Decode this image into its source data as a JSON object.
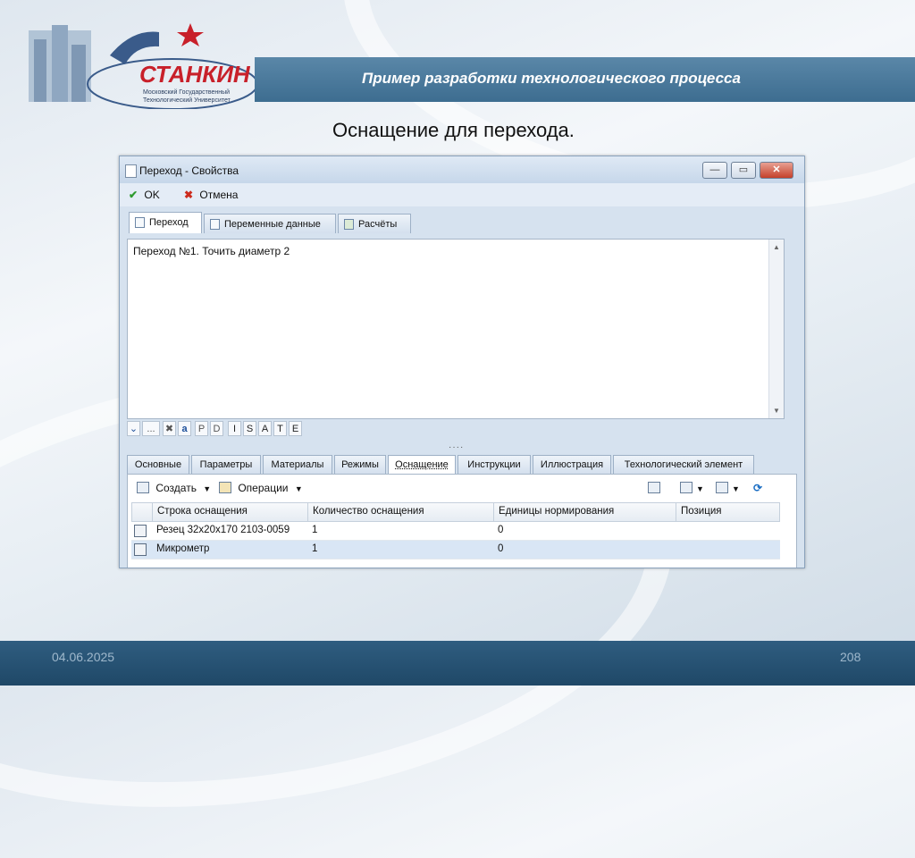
{
  "slide": {
    "header_title": "Пример разработки технологического процесса",
    "subtitle": "Оснащение для перехода.",
    "logo_text": "СТАНКИН",
    "logo_line1": "Московский Государственный",
    "logo_line2": "Технологический Университет",
    "footer_date": "04.06.2025",
    "footer_page": "208"
  },
  "window": {
    "title": "Переход - Свойства",
    "controls": {
      "minimize": "—",
      "maximize": "▭",
      "close": "✕"
    },
    "toolbar": {
      "ok_label": "OK",
      "cancel_label": "Отмена"
    },
    "top_tabs": [
      {
        "label": "Переход",
        "active": true
      },
      {
        "label": "Переменные данные",
        "active": false
      },
      {
        "label": "Расчёты",
        "active": false
      }
    ],
    "editor_text": "Переход №1. Точить диаметр 2",
    "format_buttons": [
      "P",
      "D",
      "I",
      "S",
      "A",
      "T",
      "E"
    ],
    "format_misc": {
      "more": "...",
      "grip": "····"
    },
    "bottom_tabs": [
      {
        "label": "Основные",
        "active": false
      },
      {
        "label": "Параметры",
        "active": false
      },
      {
        "label": "Материалы",
        "active": false
      },
      {
        "label": "Режимы",
        "active": false
      },
      {
        "label": "Оснащение",
        "active": true
      },
      {
        "label": "Инструкции",
        "active": false
      },
      {
        "label": "Иллюстрация",
        "active": false
      },
      {
        "label": "Технологический элемент",
        "active": false
      }
    ],
    "panel_toolbar": {
      "create_label": "Создать",
      "operations_label": "Операции"
    },
    "table": {
      "columns": [
        "Строка оснащения",
        "Количество оснащения",
        "Единицы нормирования",
        "Позиция"
      ],
      "rows": [
        [
          "Резец 32х20х170 2103-0059",
          "1",
          "0",
          ""
        ],
        [
          "Микрометр",
          "1",
          "0",
          ""
        ]
      ]
    },
    "colors": {
      "accent": "#3d6d90",
      "selected_row": "#d9e6f5",
      "ok_green": "#2e9a2e",
      "cancel_red": "#cc2b1d"
    }
  }
}
